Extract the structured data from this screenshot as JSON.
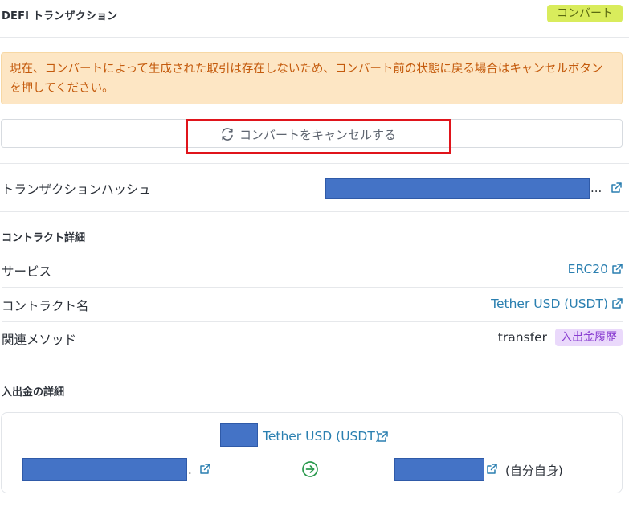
{
  "header": {
    "title": "DEFI トランザクション",
    "convert_badge": "コンバート"
  },
  "alert": {
    "message": "現在、コンバートによって生成された取引は存在しないため、コンバート前の状態に戻る場合はキャンセルボタンを押してください。"
  },
  "cancel_button": {
    "label": "コンバートをキャンセルする",
    "icon": "refresh-icon"
  },
  "transaction": {
    "hash_label": "トランザクションハッシュ",
    "hash_suffix": "..."
  },
  "contract": {
    "section_title": "コントラクト詳細",
    "service_label": "サービス",
    "service_value": "ERC20",
    "name_label": "コントラクト名",
    "name_value": "Tether USD (USDT)",
    "method_label": "関連メソッド",
    "method_value": "transfer",
    "method_badge": "入出金履歴"
  },
  "transfer": {
    "section_title": "入出金の詳細",
    "token": "Tether USD (USDT)",
    "from_suffix": ".",
    "self_label": "(自分自身)"
  },
  "colors": {
    "accent_link": "#2a7fb0",
    "alert_bg": "#fde6c4",
    "alert_text": "#c45a0c",
    "convert_badge_bg": "#d9ec5c",
    "method_badge_bg": "#ead9fb",
    "highlight": "#e0141b",
    "arrow": "#2c9a4f"
  }
}
